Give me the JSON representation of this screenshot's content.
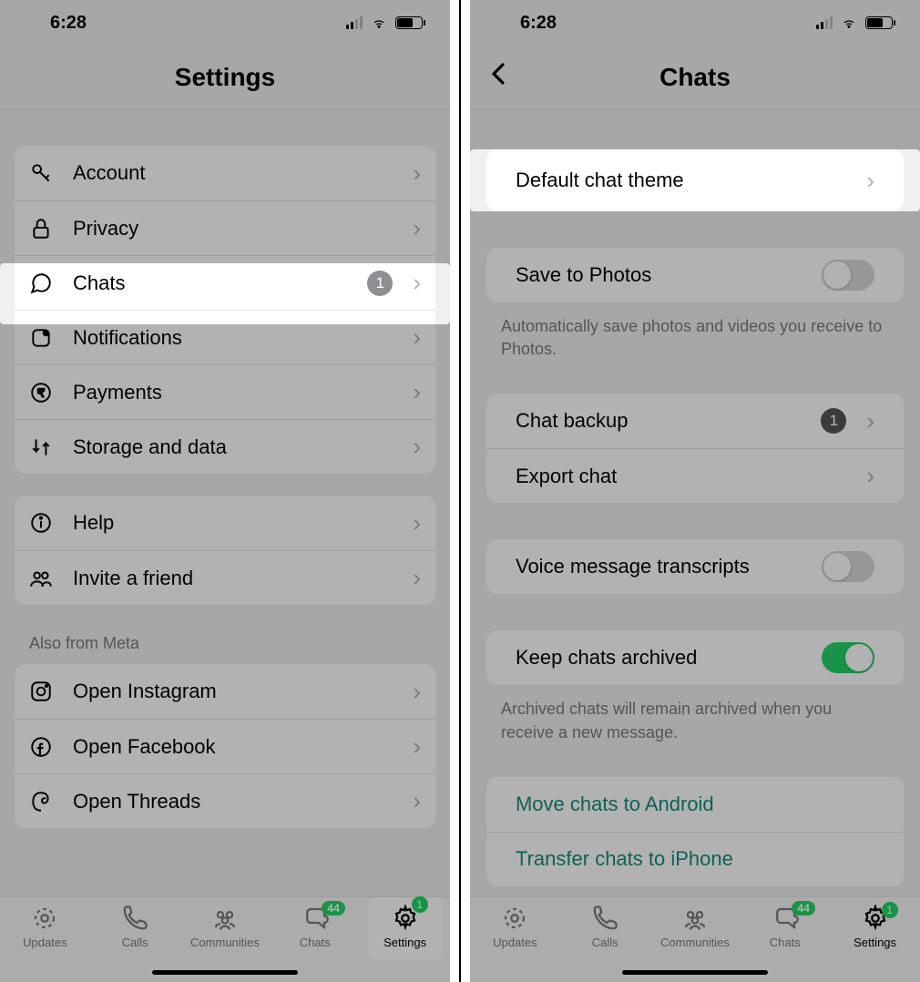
{
  "status": {
    "time": "6:28"
  },
  "left": {
    "title": "Settings",
    "items": {
      "account": "Account",
      "privacy": "Privacy",
      "chats": "Chats",
      "chats_badge": "1",
      "notifications": "Notifications",
      "payments": "Payments",
      "storage": "Storage and data",
      "help": "Help",
      "invite": "Invite a friend"
    },
    "meta_label": "Also from Meta",
    "meta": {
      "instagram": "Open Instagram",
      "facebook": "Open Facebook",
      "threads": "Open Threads"
    }
  },
  "right": {
    "title": "Chats",
    "default_theme": "Default chat theme",
    "save_photos": "Save to Photos",
    "save_photos_desc": "Automatically save photos and videos you receive to Photos.",
    "chat_backup": "Chat backup",
    "chat_backup_badge": "1",
    "export_chat": "Export chat",
    "voice_transcripts": "Voice message transcripts",
    "keep_archived": "Keep chats archived",
    "keep_archived_desc": "Archived chats will remain archived when you receive a new message.",
    "move_android": "Move chats to Android",
    "transfer_iphone": "Transfer chats to iPhone"
  },
  "tabs": {
    "updates": "Updates",
    "calls": "Calls",
    "communities": "Communities",
    "chats": "Chats",
    "chats_count": "44",
    "settings": "Settings",
    "settings_badge": "1"
  }
}
